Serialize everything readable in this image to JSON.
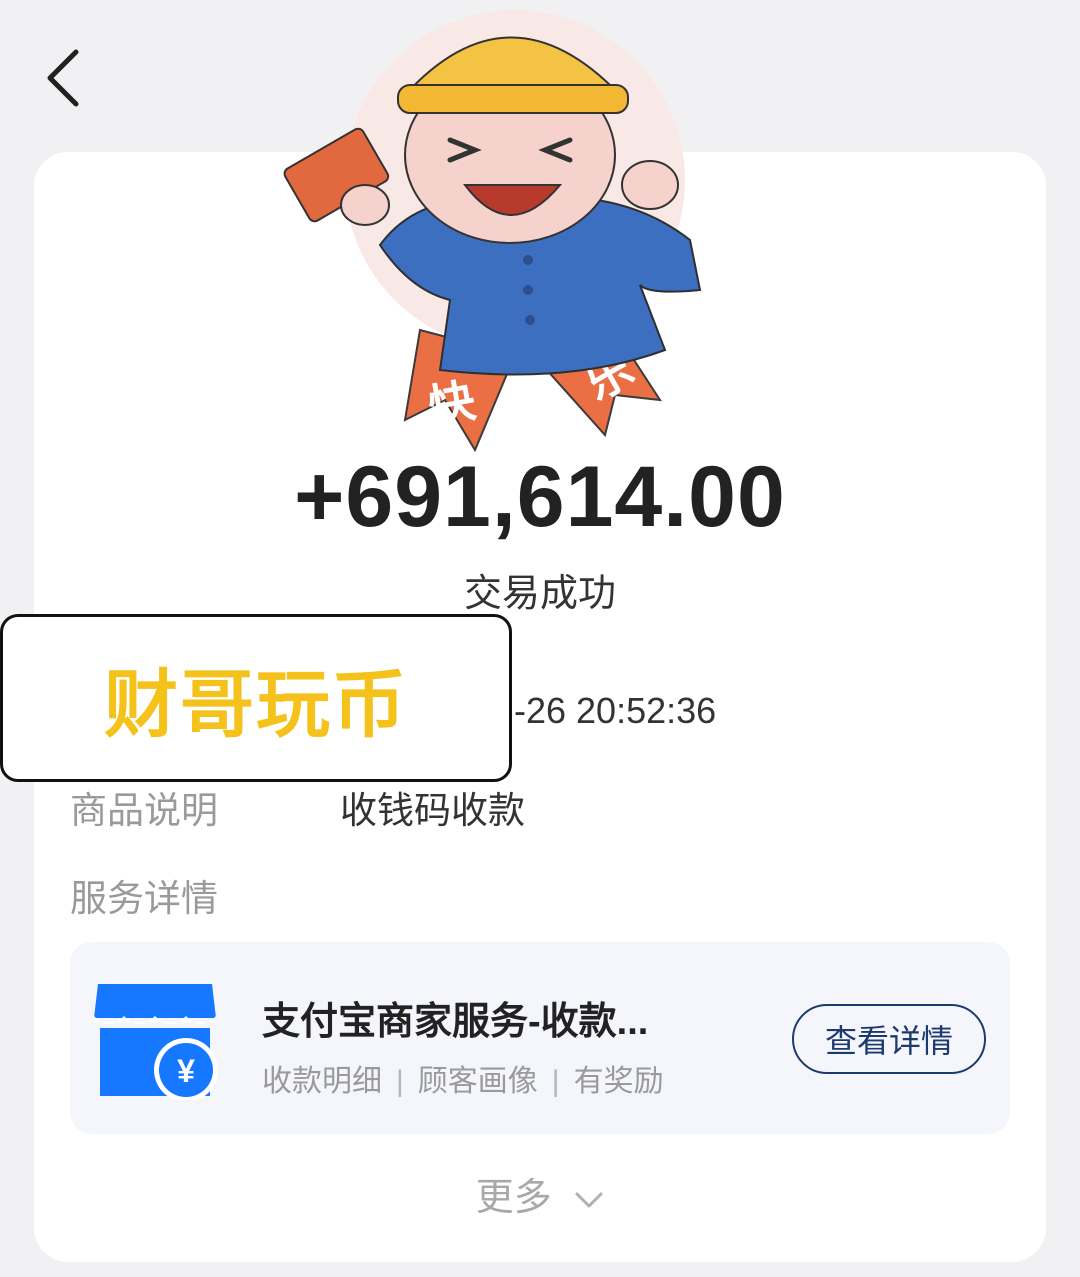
{
  "header": {
    "back_icon": "chevron-left-icon"
  },
  "transaction": {
    "amount": "+691,614.00",
    "status": "交易成功",
    "time_partial": "-26 20:52:36"
  },
  "watermark": {
    "text": "财哥玩币"
  },
  "sticker": {
    "left_ribbon": "快",
    "right_ribbon": "乐"
  },
  "details": {
    "product_label": "商品说明",
    "product_value": "收钱码收款",
    "service_label": "服务详情"
  },
  "service_card": {
    "icon": "shop-yuan-icon",
    "title": "支付宝商家服务-收款...",
    "tags": [
      "收款明细",
      "顾客画像",
      "有奖励"
    ],
    "button": "查看详情"
  },
  "footer": {
    "more_label": "更多",
    "more_icon": "chevron-down-icon"
  },
  "colors": {
    "background": "#f1f1f3",
    "card": "#ffffff",
    "accent_blue": "#1677ff",
    "button_border": "#1d3a6e",
    "watermark_text": "#f4c21a"
  }
}
